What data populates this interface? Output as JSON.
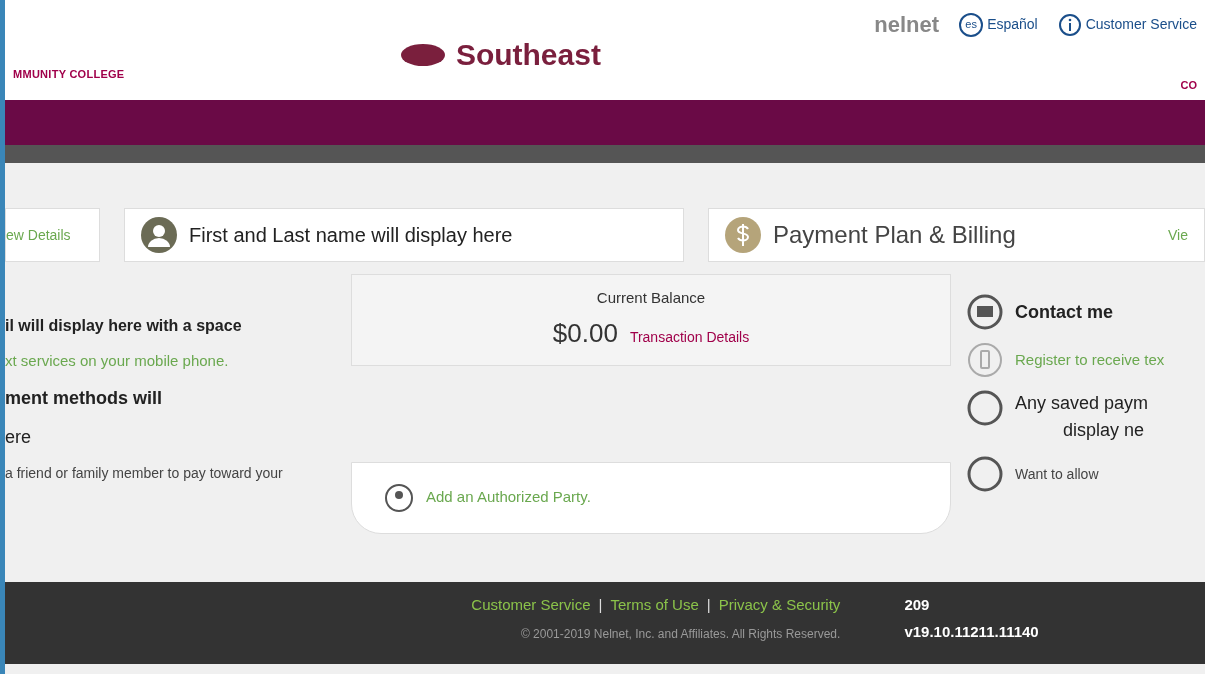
{
  "header": {
    "provider_logo": "nelnet",
    "language_link": "Español",
    "language_badge": "es",
    "service_link": "Customer Service",
    "school_logo": "Southeast",
    "school_subtitle": "MMUNITY COLLEGE",
    "school_subtitle_right": "CO"
  },
  "cards": [
    {
      "kind": "link",
      "text": "ew Details"
    },
    {
      "kind": "profile",
      "text": "First and Last name will display here"
    },
    {
      "kind": "billing",
      "text": "Payment Plan & Billing",
      "link": "Vie"
    }
  ],
  "left_column": {
    "email_text": "il will display here with a space",
    "text_link": "xt services on your mobile phone.",
    "payment_heading": "ment methods will",
    "payment_heading_2": "ere",
    "authorized_text": "a friend or family member to pay toward your"
  },
  "balance": {
    "label": "Current Balance",
    "amount": "$0.00",
    "link": "Transaction Details"
  },
  "authorized": {
    "link": "Add an Authorized Party."
  },
  "right_column": {
    "contact_heading": "Contact me",
    "text_link": "Register to receive tex",
    "saved_heading": "Any saved paym",
    "saved_heading_2": "display ne",
    "allow_text": "Want to allow"
  },
  "footer": {
    "links": [
      "Customer Service",
      "Terms of Use",
      "Privacy & Security"
    ],
    "separator": "|",
    "copyright": "© 2001-2019 Nelnet, Inc. and Affiliates. All Rights Reserved.",
    "code": "209",
    "version": "v19.10.11211.11140"
  }
}
